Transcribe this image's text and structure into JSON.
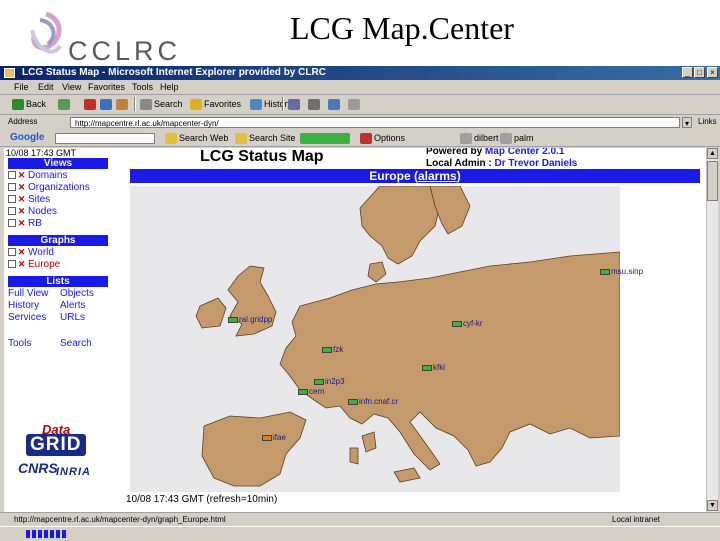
{
  "slide": {
    "title": "LCG Map.Center",
    "logo_text": "CCLRC"
  },
  "window": {
    "title": "LCG Status Map - Microsoft Internet Explorer provided by CLRC",
    "menu": [
      "File",
      "Edit",
      "View",
      "Favorites",
      "Tools",
      "Help"
    ],
    "toolbar": {
      "back": "Back",
      "search": "Search",
      "favorites": "Favorites",
      "history": "History"
    },
    "address": {
      "label": "Address",
      "url": "http://mapcentre.rl.ac.uk/mapcenter-dyn/",
      "go": "▾",
      "links": "Links"
    },
    "google": {
      "logo": "Google",
      "search_web": "Search Web",
      "search_site": "Search Site",
      "page_rank": "PageRank",
      "options": "Options",
      "dilbert": "dilbert",
      "palm": "palm"
    },
    "status": "http://mapcentre.rl.ac.uk/mapcenter-dyn/graph_Europe.html",
    "zone": "Local intranet"
  },
  "nav": {
    "time": "10/08 17:43 GMT",
    "views_header": "Views",
    "views": [
      "Domains",
      "Organizations",
      "Sites",
      "Nodes",
      "RB"
    ],
    "graphs_header": "Graphs",
    "graphs": [
      "World",
      "Europe"
    ],
    "lists_header": "Lists",
    "lists": [
      [
        "Full View",
        "Objects"
      ],
      [
        "History",
        "Alerts"
      ],
      [
        "Services",
        "URLs"
      ],
      [
        "Tools",
        "Search"
      ]
    ]
  },
  "logos": {
    "datagrid_top": "Data",
    "datagrid_bottom": "GRID",
    "cnrs": "CNRS",
    "inria": "INRIA"
  },
  "page": {
    "title": "LCG Status Map",
    "powered_label": "Powered by",
    "powered_link": "Map Center 2.0.1",
    "admin_label": "Local Admin :",
    "admin_link": "Dr Trevor Daniels",
    "region": "Europe",
    "alarms": "alarms",
    "refresh": "10/08 17:43 GMT (refresh=10min)"
  },
  "sites": [
    {
      "id": "msu",
      "label": "msu.sinp",
      "status": "ok"
    },
    {
      "id": "ral",
      "label": "ral.gridpp",
      "status": "ok"
    },
    {
      "id": "cyf",
      "label": "cyf-kr",
      "status": "ok"
    },
    {
      "id": "fzk",
      "label": "fzk",
      "status": "ok"
    },
    {
      "id": "kfki",
      "label": "kfki",
      "status": "ok"
    },
    {
      "id": "ccin2p3",
      "label": "in2p3",
      "status": "ok"
    },
    {
      "id": "cern",
      "label": "cern",
      "status": "ok"
    },
    {
      "id": "infn",
      "label": "infn.cnaf.cr",
      "status": "ok"
    },
    {
      "id": "pic",
      "label": "ifae",
      "status": "alarm"
    }
  ],
  "colors": {
    "accent": "#1a1ae6",
    "land": "#c49a6c",
    "sea": "#e8e8ea",
    "ok": "#3cb043",
    "alarm": "#e07a20"
  }
}
